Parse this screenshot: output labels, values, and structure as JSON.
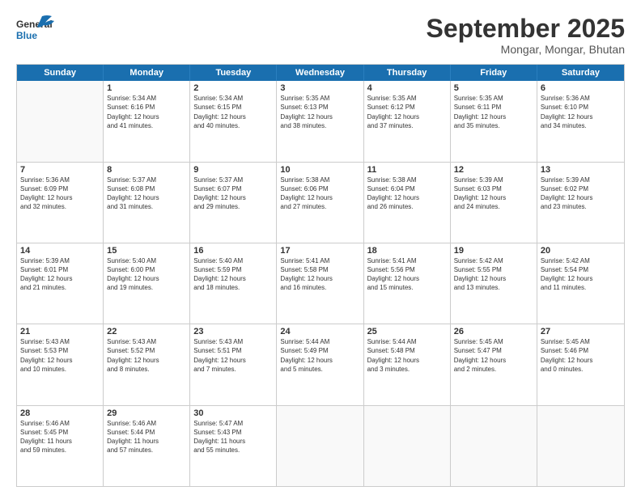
{
  "header": {
    "logo_line1": "General",
    "logo_line2": "Blue",
    "month": "September 2025",
    "location": "Mongar, Mongar, Bhutan"
  },
  "days_of_week": [
    "Sunday",
    "Monday",
    "Tuesday",
    "Wednesday",
    "Thursday",
    "Friday",
    "Saturday"
  ],
  "weeks": [
    [
      {
        "day": "",
        "info": ""
      },
      {
        "day": "1",
        "info": "Sunrise: 5:34 AM\nSunset: 6:16 PM\nDaylight: 12 hours\nand 41 minutes."
      },
      {
        "day": "2",
        "info": "Sunrise: 5:34 AM\nSunset: 6:15 PM\nDaylight: 12 hours\nand 40 minutes."
      },
      {
        "day": "3",
        "info": "Sunrise: 5:35 AM\nSunset: 6:13 PM\nDaylight: 12 hours\nand 38 minutes."
      },
      {
        "day": "4",
        "info": "Sunrise: 5:35 AM\nSunset: 6:12 PM\nDaylight: 12 hours\nand 37 minutes."
      },
      {
        "day": "5",
        "info": "Sunrise: 5:35 AM\nSunset: 6:11 PM\nDaylight: 12 hours\nand 35 minutes."
      },
      {
        "day": "6",
        "info": "Sunrise: 5:36 AM\nSunset: 6:10 PM\nDaylight: 12 hours\nand 34 minutes."
      }
    ],
    [
      {
        "day": "7",
        "info": "Sunrise: 5:36 AM\nSunset: 6:09 PM\nDaylight: 12 hours\nand 32 minutes."
      },
      {
        "day": "8",
        "info": "Sunrise: 5:37 AM\nSunset: 6:08 PM\nDaylight: 12 hours\nand 31 minutes."
      },
      {
        "day": "9",
        "info": "Sunrise: 5:37 AM\nSunset: 6:07 PM\nDaylight: 12 hours\nand 29 minutes."
      },
      {
        "day": "10",
        "info": "Sunrise: 5:38 AM\nSunset: 6:06 PM\nDaylight: 12 hours\nand 27 minutes."
      },
      {
        "day": "11",
        "info": "Sunrise: 5:38 AM\nSunset: 6:04 PM\nDaylight: 12 hours\nand 26 minutes."
      },
      {
        "day": "12",
        "info": "Sunrise: 5:39 AM\nSunset: 6:03 PM\nDaylight: 12 hours\nand 24 minutes."
      },
      {
        "day": "13",
        "info": "Sunrise: 5:39 AM\nSunset: 6:02 PM\nDaylight: 12 hours\nand 23 minutes."
      }
    ],
    [
      {
        "day": "14",
        "info": "Sunrise: 5:39 AM\nSunset: 6:01 PM\nDaylight: 12 hours\nand 21 minutes."
      },
      {
        "day": "15",
        "info": "Sunrise: 5:40 AM\nSunset: 6:00 PM\nDaylight: 12 hours\nand 19 minutes."
      },
      {
        "day": "16",
        "info": "Sunrise: 5:40 AM\nSunset: 5:59 PM\nDaylight: 12 hours\nand 18 minutes."
      },
      {
        "day": "17",
        "info": "Sunrise: 5:41 AM\nSunset: 5:58 PM\nDaylight: 12 hours\nand 16 minutes."
      },
      {
        "day": "18",
        "info": "Sunrise: 5:41 AM\nSunset: 5:56 PM\nDaylight: 12 hours\nand 15 minutes."
      },
      {
        "day": "19",
        "info": "Sunrise: 5:42 AM\nSunset: 5:55 PM\nDaylight: 12 hours\nand 13 minutes."
      },
      {
        "day": "20",
        "info": "Sunrise: 5:42 AM\nSunset: 5:54 PM\nDaylight: 12 hours\nand 11 minutes."
      }
    ],
    [
      {
        "day": "21",
        "info": "Sunrise: 5:43 AM\nSunset: 5:53 PM\nDaylight: 12 hours\nand 10 minutes."
      },
      {
        "day": "22",
        "info": "Sunrise: 5:43 AM\nSunset: 5:52 PM\nDaylight: 12 hours\nand 8 minutes."
      },
      {
        "day": "23",
        "info": "Sunrise: 5:43 AM\nSunset: 5:51 PM\nDaylight: 12 hours\nand 7 minutes."
      },
      {
        "day": "24",
        "info": "Sunrise: 5:44 AM\nSunset: 5:49 PM\nDaylight: 12 hours\nand 5 minutes."
      },
      {
        "day": "25",
        "info": "Sunrise: 5:44 AM\nSunset: 5:48 PM\nDaylight: 12 hours\nand 3 minutes."
      },
      {
        "day": "26",
        "info": "Sunrise: 5:45 AM\nSunset: 5:47 PM\nDaylight: 12 hours\nand 2 minutes."
      },
      {
        "day": "27",
        "info": "Sunrise: 5:45 AM\nSunset: 5:46 PM\nDaylight: 12 hours\nand 0 minutes."
      }
    ],
    [
      {
        "day": "28",
        "info": "Sunrise: 5:46 AM\nSunset: 5:45 PM\nDaylight: 11 hours\nand 59 minutes."
      },
      {
        "day": "29",
        "info": "Sunrise: 5:46 AM\nSunset: 5:44 PM\nDaylight: 11 hours\nand 57 minutes."
      },
      {
        "day": "30",
        "info": "Sunrise: 5:47 AM\nSunset: 5:43 PM\nDaylight: 11 hours\nand 55 minutes."
      },
      {
        "day": "",
        "info": ""
      },
      {
        "day": "",
        "info": ""
      },
      {
        "day": "",
        "info": ""
      },
      {
        "day": "",
        "info": ""
      }
    ]
  ]
}
